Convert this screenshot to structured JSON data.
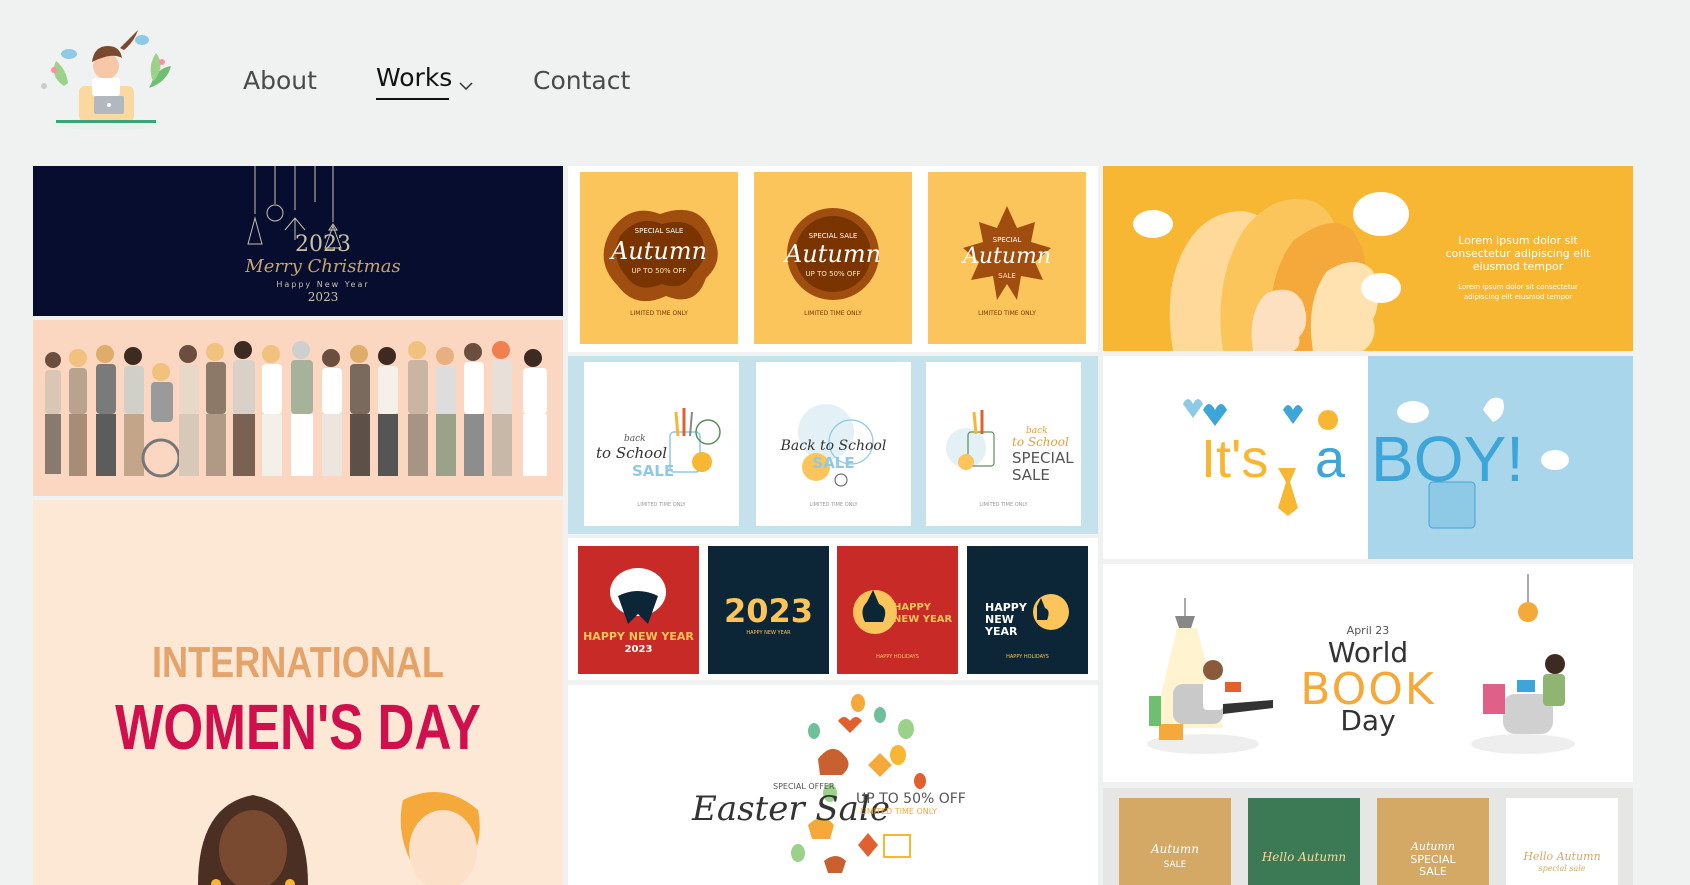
{
  "header": {
    "nav": [
      {
        "label": "About"
      },
      {
        "label": "Works"
      },
      {
        "label": "Contact"
      }
    ]
  },
  "gallery": {
    "christmas": {
      "title": "Merry Christmas",
      "year": "2023",
      "subtitle": "Happy New Year"
    },
    "autumn": [
      {
        "special": "SPECIAL SALE",
        "title": "Autumn",
        "offer": "UP TO 50% OFF",
        "footer": "LIMITED TIME ONLY"
      },
      {
        "special": "SPECIAL SALE",
        "title": "Autumn",
        "offer": "UP TO 50% OFF",
        "footer": "LIMITED TIME ONLY"
      },
      {
        "special": "SPECIAL",
        "title": "Autumn",
        "offer": "SALE",
        "footer": "LIMITED TIME ONLY"
      }
    ],
    "lorem": {
      "heading": "Lorem ipsum dolor sit consectetur adipiscing elit eiusmod tempor",
      "body": "Lorem ipsum dolor sit consectetur adipiscing elit eiusmod tempor"
    },
    "school": [
      {
        "line1": "back",
        "line2": "to School",
        "line3": "SALE",
        "footer": "LIMITED TIME ONLY"
      },
      {
        "line1": "",
        "line2": "Back to School",
        "line3": "SALE",
        "footer": "LIMITED TIME ONLY"
      },
      {
        "line1": "back",
        "line2": "to School",
        "line3": "SPECIAL SALE",
        "footer": "LIMITED TIME ONLY"
      }
    ],
    "boy": {
      "part1": "It's",
      "part2": "a",
      "part3": "BOY!"
    },
    "newyear": [
      {
        "title": "HAPPY NEW YEAR",
        "year": "2023"
      },
      {
        "title": "2023",
        "sub": "HAPPY NEW YEAR"
      },
      {
        "title": "HAPPY NEW YEAR",
        "sub": "HAPPY HOLIDAYS"
      },
      {
        "title": "HAPPY NEW YEAR",
        "sub": "HAPPY HOLIDAYS"
      }
    ],
    "book": {
      "date": "April 23",
      "word1": "World",
      "word2": "BOOK",
      "word3": "Day"
    },
    "womens": {
      "line1": "INTERNATIONAL",
      "line2": "WOMEN'S DAY"
    },
    "easter": {
      "special": "SPECIAL OFFER",
      "title": "Easter Sale",
      "offer": "UP TO 50% OFF",
      "limited": "LIMITED TIME ONLY"
    },
    "autumn2": [
      {
        "title": "Autumn",
        "sub": "SALE"
      },
      {
        "title": "Hello Autumn"
      },
      {
        "title": "Autumn",
        "sub": "SPECIAL SALE"
      },
      {
        "title": "Hello Autumn",
        "sub": "special sale"
      }
    ]
  },
  "colors": {
    "bg": "#eff2f1",
    "navy": "#060d2e",
    "orange": "#fcc55c",
    "yellow": "#f7b733",
    "lightblue": "#c5e2ec",
    "red": "#c82a27",
    "darknavy": "#0c2637",
    "peach": "#fde8d6",
    "crimson": "#d0104c"
  }
}
